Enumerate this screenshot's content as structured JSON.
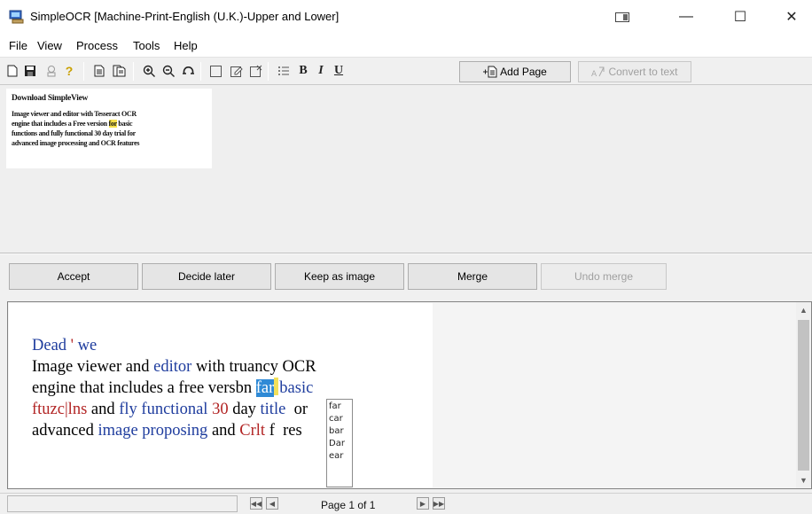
{
  "window": {
    "title": "SimpleOCR [Machine-Print-English (U.K.)-Upper and Lower]",
    "snap_icon": "snap-layout-icon",
    "minimize_glyph": "—",
    "maximize_glyph": "☐",
    "close_glyph": "✕"
  },
  "menu": {
    "file": "File",
    "view": "View",
    "process": "Process",
    "tools": "Tools",
    "help": "Help"
  },
  "toolbar": {
    "icons": [
      "new-document-icon",
      "save-icon",
      "scanner-icon",
      "help-icon",
      "single-page-icon",
      "multi-page-icon",
      "zoom-in-icon",
      "zoom-out-icon",
      "zoom-reset-icon",
      "select-region-icon",
      "edit-region-icon",
      "delete-region-icon",
      "bullet-list-icon",
      "bold-icon",
      "italic-icon",
      "underline-icon"
    ],
    "bold_glyph": "B",
    "italic_glyph": "I",
    "underline_glyph": "U",
    "add_page": "Add Page",
    "convert": "Convert to text"
  },
  "image_preview": {
    "heading": "Download SimpleView",
    "line1": "Image viewer and editor with Tesseract OCR",
    "line2_pre": "engine that includes a Free version ",
    "line2_hl": "for",
    "line2_post": " basic",
    "line3": "functions and fully functional 30  day trial for",
    "line4": "advanced image processing and OCR features"
  },
  "actions": {
    "accept": "Accept",
    "decide_later": "Decide later",
    "keep_as_image": "Keep as image",
    "merge": "Merge",
    "undo_merge": "Undo merge"
  },
  "ocr": {
    "l1_a": "Dead",
    "l1_b": " ' ",
    "l1_c": "we",
    "l2_a": "Image viewer and ",
    "l2_b": "editor",
    "l2_c": " with truancy OCR",
    "l3_a": "engine that includes a free versbn ",
    "l3_b": "far",
    "l3_c": " ",
    "l3_d": "basic",
    "l4_a": "ftuzc|lns",
    "l4_b": " and ",
    "l4_c": "fly functional",
    "l4_d": " ",
    "l4_e": "30",
    "l4_f": " day ",
    "l4_g": "title",
    "l4_h": "  or",
    "l5_a": "advanced ",
    "l5_b": "image proposing",
    "l5_c": " and ",
    "l5_d": "Crlt",
    "l5_e": " f",
    "l5_f": "  res",
    "suggestions": [
      "far",
      "car",
      "bar",
      "Dar",
      "ear"
    ]
  },
  "status": {
    "page": "Page 1 of 1"
  },
  "colors": {
    "word_blue": "#1f3d9e",
    "word_red": "#b22424",
    "selection": "#2f8ad6",
    "highlight": "#f5e04a"
  }
}
